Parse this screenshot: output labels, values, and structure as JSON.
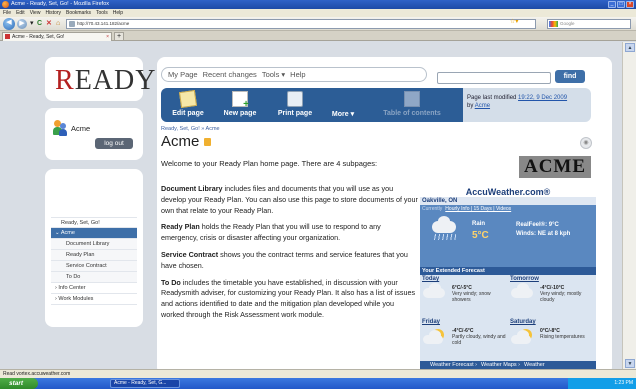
{
  "browser": {
    "window_title": "Acme - Ready, Set, Go! - Mozilla Firefox",
    "menu": [
      "File",
      "Edit",
      "View",
      "History",
      "Bookmarks",
      "Tools",
      "Help"
    ],
    "url": "http://70.43.141.182/acme",
    "search_placeholder": "Google",
    "tab_title": "Acme - Ready, Set, Go!",
    "status_text": "Read vortex.accuweather.com"
  },
  "site": {
    "logo_text": "EADY",
    "logo_first": "R",
    "user_name": "Acme",
    "logout_label": "log out"
  },
  "sidebar": {
    "items": [
      {
        "label": "Ready, Set, Go!"
      },
      {
        "label": "⌄ Acme"
      },
      {
        "label": "Document Library"
      },
      {
        "label": "Ready Plan"
      },
      {
        "label": "Service Contract"
      },
      {
        "label": "To Do"
      },
      {
        "label": "› Info Center"
      },
      {
        "label": "› Work Modules"
      }
    ]
  },
  "topnav": {
    "my_page": "My Page",
    "recent_changes": "Recent changes",
    "tools": "Tools ▾",
    "help": "Help",
    "find_label": "find"
  },
  "toolbar": {
    "edit": "Edit page",
    "new": "New page",
    "print": "Print page",
    "more": "More ▾",
    "toc": "Table of contents",
    "last_modified_prefix": "Page last modified ",
    "last_modified_date": "19:22, 9 Dec 2009",
    "by": "by ",
    "author": "Acme"
  },
  "page": {
    "breadcrumb": "Ready, Set, Go! » Acme",
    "title": "Acme",
    "acme_logo": "ACME",
    "intro": "Welcome to your Ready Plan home page.  There are 4 subpages:",
    "sections": [
      {
        "heading": "Document Library",
        "text": " includes files and documents that you will use as you develop your Ready Plan.  You can also use this page to store documents of your own that relate to your Ready Plan."
      },
      {
        "heading": "Ready Plan",
        "text": " holds the Ready Plan that you will use to respond to any emergency, crisis or disaster affecting your organization."
      },
      {
        "heading": "Service Contract",
        "text": " shows you the contract terms and service features that you have chosen."
      },
      {
        "heading": "To Do",
        "text": " includes the timetable you have established, in discussion with your Readysmith adviser, for customizing your Ready Plan.  It also has a list of issues and actions identified to date and the mitigation plan developed while you worked through the Risk Assessment work module."
      }
    ]
  },
  "weather": {
    "brand": "AccuWeather.com®",
    "city": "Oakville, ON",
    "links_current": "Currently",
    "links": "Hourly Info | 15 Days | Videos",
    "now_condition": "Rain",
    "now_temp": "5°C",
    "realfeel": "RealFeel®: 9°C",
    "winds": "Winds: NE at 8 kph",
    "extended_title": "Your Extended Forecast",
    "forecast": [
      {
        "day": "Today",
        "temp": "6°C/-5°C",
        "desc": "Very windy; snow showers"
      },
      {
        "day": "Tomorrow",
        "temp": "-4°C/-10°C",
        "desc": "Very windy; mostly cloudy"
      },
      {
        "day": "Friday",
        "temp": "-4°C/-6°C",
        "desc": "Partly cloudy, windy and cold"
      },
      {
        "day": "Saturday",
        "temp": "0°C/-8°C",
        "desc": "Rising temperatures"
      }
    ],
    "footer": [
      "Weather Forecast ›",
      "Weather Maps ›",
      "Weather"
    ]
  },
  "taskbar": {
    "start": "start",
    "task": "Acme - Ready, Set, G...",
    "clock": "1:23 PM"
  }
}
